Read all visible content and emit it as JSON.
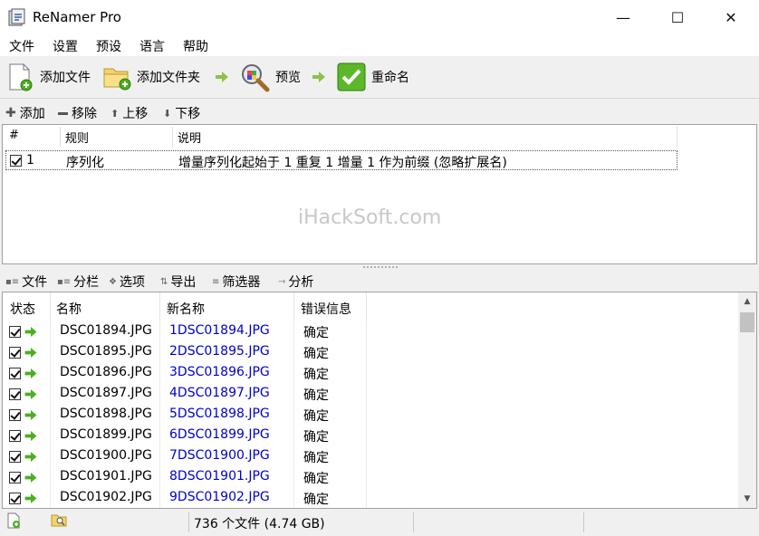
{
  "window": {
    "title": "ReNamer Pro",
    "minimize": "—",
    "maximize": "☐",
    "close": "✕"
  },
  "menu": [
    "文件",
    "设置",
    "预设",
    "语言",
    "帮助"
  ],
  "toolbar": {
    "add_files": "添加文件",
    "add_folder": "添加文件夹",
    "preview": "预览",
    "rename": "重命名"
  },
  "rules_toolbar": {
    "add": "添加",
    "remove": "移除",
    "move_up": "上移",
    "move_down": "下移"
  },
  "rules": {
    "headers": {
      "num": "#",
      "rule": "规则",
      "desc": "说明"
    },
    "rows": [
      {
        "checked": true,
        "num": "1",
        "rule": "序列化",
        "desc": "增量序列化起始于 1 重复 1 增量 1 作为前缀 (忽略扩展名)"
      }
    ],
    "watermark": "iHackSoft.com"
  },
  "files_toolbar": {
    "files": "文件",
    "columns": "分栏",
    "options": "选项",
    "export": "导出",
    "filter": "筛选器",
    "analyze": "分析"
  },
  "files": {
    "headers": {
      "state": "状态",
      "name": "名称",
      "new_name": "新名称",
      "error": "错误信息"
    },
    "rows": [
      {
        "checked": true,
        "name": "DSC01894.JPG",
        "new_name": "1DSC01894.JPG",
        "error": "确定"
      },
      {
        "checked": true,
        "name": "DSC01895.JPG",
        "new_name": "2DSC01895.JPG",
        "error": "确定"
      },
      {
        "checked": true,
        "name": "DSC01896.JPG",
        "new_name": "3DSC01896.JPG",
        "error": "确定"
      },
      {
        "checked": true,
        "name": "DSC01897.JPG",
        "new_name": "4DSC01897.JPG",
        "error": "确定"
      },
      {
        "checked": true,
        "name": "DSC01898.JPG",
        "new_name": "5DSC01898.JPG",
        "error": "确定"
      },
      {
        "checked": true,
        "name": "DSC01899.JPG",
        "new_name": "6DSC01899.JPG",
        "error": "确定"
      },
      {
        "checked": true,
        "name": "DSC01900.JPG",
        "new_name": "7DSC01900.JPG",
        "error": "确定"
      },
      {
        "checked": true,
        "name": "DSC01901.JPG",
        "new_name": "8DSC01901.JPG",
        "error": "确定"
      },
      {
        "checked": true,
        "name": "DSC01902.JPG",
        "new_name": "9DSC01902.JPG",
        "error": "确定"
      }
    ]
  },
  "status": {
    "summary": "736 个文件 (4.74 GB)"
  },
  "colors": {
    "accent_green": "#4caf1f",
    "new_name_blue": "#0000cc"
  }
}
